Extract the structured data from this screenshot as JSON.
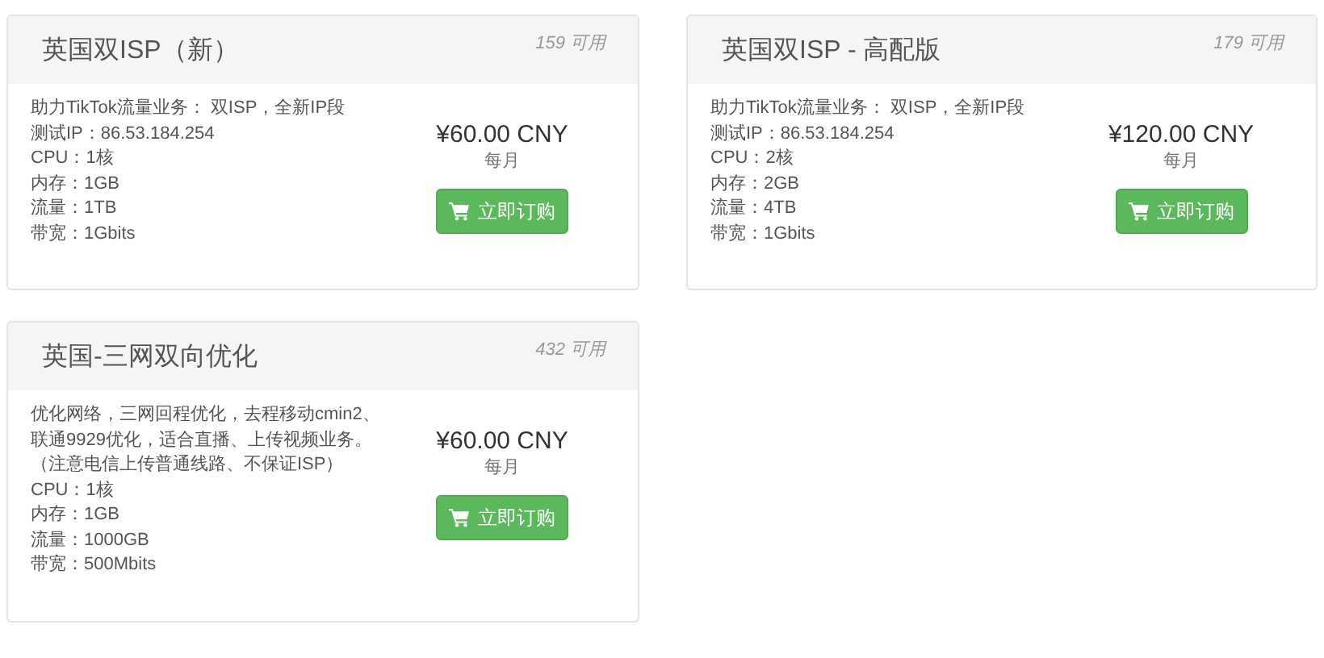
{
  "products": [
    {
      "name": "英国双ISP（新）",
      "available": "159 可用",
      "description": [
        "助力TikTok流量业务： 双ISP，全新IP段",
        "测试IP：86.53.184.254",
        "CPU：1核",
        "内存：1GB",
        "流量：1TB",
        "带宽：1Gbits"
      ],
      "price": "¥60.00 CNY",
      "period": "每月",
      "order_button": "立即订购"
    },
    {
      "name": "英国双ISP - 高配版",
      "available": "179 可用",
      "description": [
        "助力TikTok流量业务： 双ISP，全新IP段",
        "测试IP：86.53.184.254",
        "CPU：2核",
        "内存：2GB",
        "流量：4TB",
        "带宽：1Gbits"
      ],
      "price": "¥120.00 CNY",
      "period": "每月",
      "order_button": "立即订购"
    },
    {
      "name": "英国-三网双向优化",
      "available": "432 可用",
      "description": [
        "优化网络，三网回程优化，去程移动cmin2、联通9929优化，适合直播、上传视频业务。（注意电信上传普通线路、不保证ISP）",
        "CPU：1核",
        "内存：1GB",
        "流量：1000GB",
        "带宽：500Mbits"
      ],
      "price": "¥60.00 CNY",
      "period": "每月",
      "order_button": "立即订购"
    }
  ]
}
